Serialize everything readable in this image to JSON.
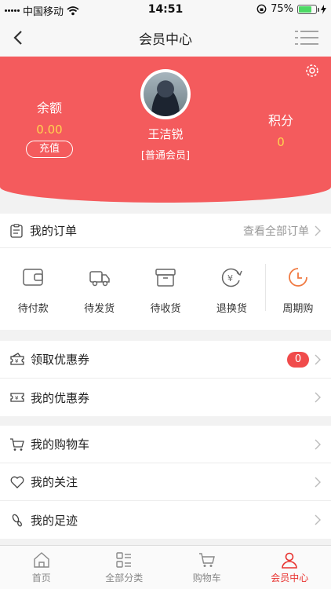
{
  "status_bar": {
    "carrier": "中国移动",
    "time": "14:51",
    "battery": "75%"
  },
  "nav": {
    "title": "会员中心"
  },
  "profile": {
    "balance_label": "余额",
    "balance_value": "0.00",
    "recharge_label": "充值",
    "user_name": "王洁锐",
    "member_level": "[普通会员]",
    "points_label": "积分",
    "points_value": "0"
  },
  "orders": {
    "title": "我的订单",
    "view_all": "查看全部订单",
    "items": [
      {
        "label": "待付款",
        "icon": "wallet-icon"
      },
      {
        "label": "待发货",
        "icon": "truck-icon"
      },
      {
        "label": "待收货",
        "icon": "box-icon"
      },
      {
        "label": "退换货",
        "icon": "refund-icon"
      },
      {
        "label": "周期购",
        "icon": "clock-icon"
      }
    ]
  },
  "coupons": [
    {
      "label": "领取优惠券",
      "badge": "0",
      "icon": "coupon-get-icon"
    },
    {
      "label": "我的优惠券",
      "icon": "coupon-icon"
    }
  ],
  "menu": [
    {
      "label": "我的购物车",
      "icon": "cart-icon"
    },
    {
      "label": "我的关注",
      "icon": "heart-icon"
    },
    {
      "label": "我的足迹",
      "icon": "footprint-icon"
    }
  ],
  "tabs": [
    {
      "label": "首页",
      "icon": "home-icon"
    },
    {
      "label": "全部分类",
      "icon": "category-icon"
    },
    {
      "label": "购物车",
      "icon": "cart-icon"
    },
    {
      "label": "会员中心",
      "icon": "user-icon",
      "active": true
    }
  ],
  "colors": {
    "accent": "#f45b5d",
    "highlight": "#ffd34f",
    "active_tab": "#e8322f",
    "badge": "#f04b4b"
  }
}
